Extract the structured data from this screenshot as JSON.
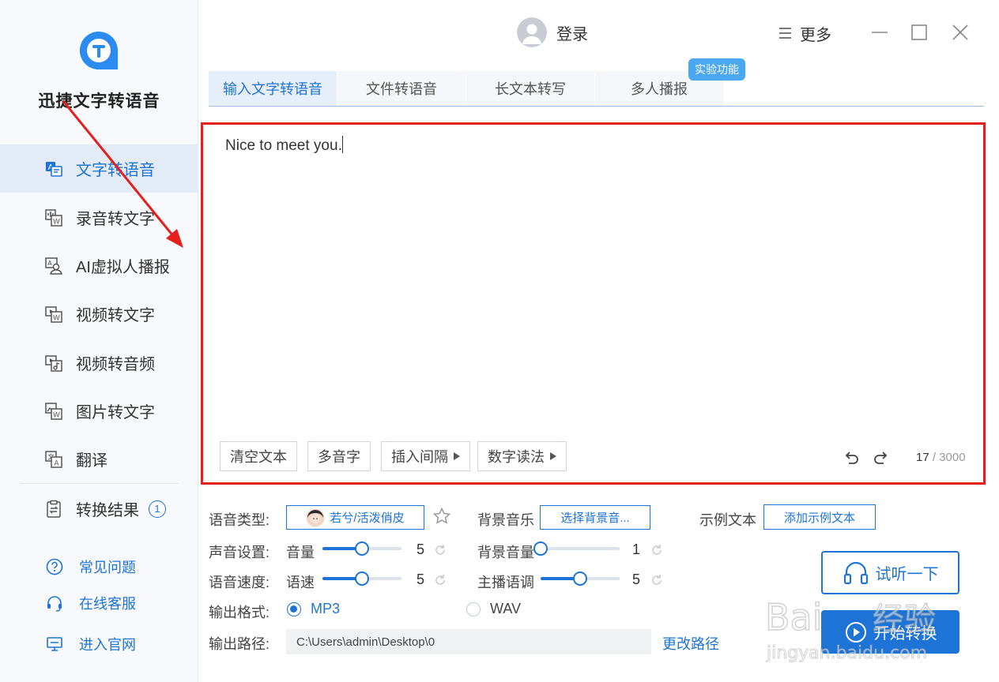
{
  "app": {
    "title": "迅捷文字转语音"
  },
  "sidebar": {
    "items": [
      {
        "label": "文字转语音",
        "icon": "text-to-speech-icon"
      },
      {
        "label": "录音转文字",
        "icon": "audio-to-text-icon"
      },
      {
        "label": "AI虚拟人播报",
        "icon": "virtual-anchor-icon"
      },
      {
        "label": "视频转文字",
        "icon": "video-to-text-icon"
      },
      {
        "label": "视频转音频",
        "icon": "video-to-audio-icon"
      },
      {
        "label": "图片转文字",
        "icon": "image-to-text-icon"
      },
      {
        "label": "翻译",
        "icon": "translate-icon"
      }
    ],
    "results": {
      "label": "转换结果",
      "count": "1"
    },
    "footer": [
      {
        "label": "常见问题",
        "icon": "help-icon"
      },
      {
        "label": "在线客服",
        "icon": "headset-icon"
      },
      {
        "label": "进入官网",
        "icon": "monitor-icon"
      }
    ]
  },
  "header": {
    "login_label": "登录",
    "more_label": "更多"
  },
  "tabs": [
    {
      "label": "输入文字转语音",
      "active": true
    },
    {
      "label": "文件转语音",
      "active": false
    },
    {
      "label": "长文本转写",
      "active": false
    },
    {
      "label": "多人播报",
      "active": false
    }
  ],
  "experimental_badge": "实验功能",
  "editor": {
    "text": "Nice to meet you.",
    "buttons": {
      "clear": "清空文本",
      "polyphone": "多音字",
      "insert_pause": "插入间隔",
      "number_reading": "数字读法"
    },
    "char_count": "17",
    "char_max": "/ 3000"
  },
  "settings": {
    "voice_type_label": "语音类型:",
    "voice_name": "若兮/活泼俏皮",
    "bgm_label": "背景音乐",
    "bgm_button": "选择背景音...",
    "sample_label": "示例文本",
    "sample_button": "添加示例文本",
    "sound_label": "声音设置:",
    "volume_label": "音量",
    "volume_value": "5",
    "volume_level": 0.5,
    "bg_volume_label": "背景音量",
    "bg_volume_value": "1",
    "bg_volume_level": 0.0,
    "speed_label": "语音速度:",
    "rate_label": "语速",
    "rate_value": "5",
    "rate_level": 0.5,
    "pitch_label": "主播语调",
    "pitch_value": "5",
    "pitch_level": 0.5,
    "format_label": "输出格式:",
    "format_mp3": "MP3",
    "format_wav": "WAV",
    "format_selected": "MP3",
    "path_label": "输出路径:",
    "path_value": "C:\\Users\\admin\\Desktop\\0",
    "change_path": "更改路径"
  },
  "actions": {
    "listen": "试听一下",
    "start": "开始转换"
  },
  "colors": {
    "accent": "#1e74d6",
    "highlight_border": "#e51e1e",
    "badge_bg": "#4aa7f2"
  }
}
